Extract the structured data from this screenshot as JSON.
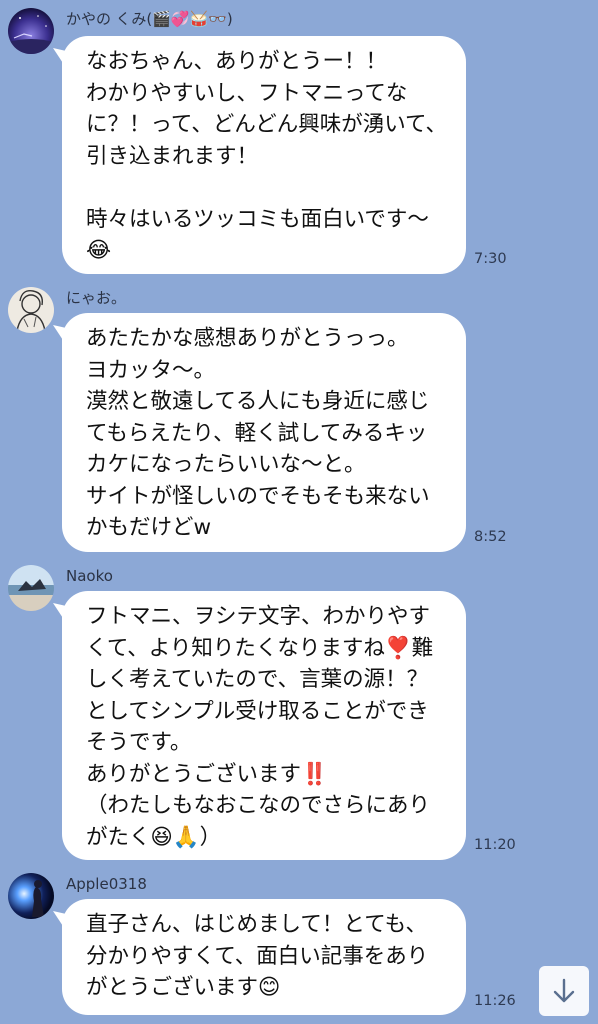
{
  "messages": [
    {
      "sender": "かやの くみ(🎬💞🥁👓)",
      "text": "なおちゃん、ありがとうー！！\nわかりやすいし、フトマニってなに？！って、どんどん興味が湧いて、引き込まれます！\n\n時々はいるツッコミも面白いです〜😂",
      "time": "7:30",
      "avatar_icon": "night-sky-avatar"
    },
    {
      "sender": "にゃお。",
      "text": "あたたかな感想ありがとうっっ。\nヨカッタ〜。\n漠然と敬遠してる人にも身近に感じてもらえたり、軽く試してみるキッカケになったらいいな〜と。\nサイトが怪しいのでそもそも来ないかもだけどw",
      "time": "8:52",
      "avatar_icon": "sketch-portrait-avatar"
    },
    {
      "sender": "Naoko",
      "text": "フトマニ、ヲシテ文字、わかりやすくて、より知りたくなりますね❣️難しく考えていたので、言葉の源！？としてシンプル受け取ることができそうです。\nありがとうございます‼️\n（わたしもなおこなのでさらにありがたく😆🙏）",
      "time": "11:20",
      "avatar_icon": "beach-sea-avatar"
    },
    {
      "sender": "Apple0318",
      "text": "直子さん、はじめまして！とても、分かりやすくて、面白い記事をありがとうございます😊",
      "time": "11:26",
      "avatar_icon": "light-figure-avatar"
    }
  ],
  "scroll_button": {
    "icon": "arrow-down-icon"
  },
  "colors": {
    "background": "#8CA8D6",
    "bubble": "#FFFFFF",
    "text": "#111111",
    "time": "#2E3A52"
  }
}
